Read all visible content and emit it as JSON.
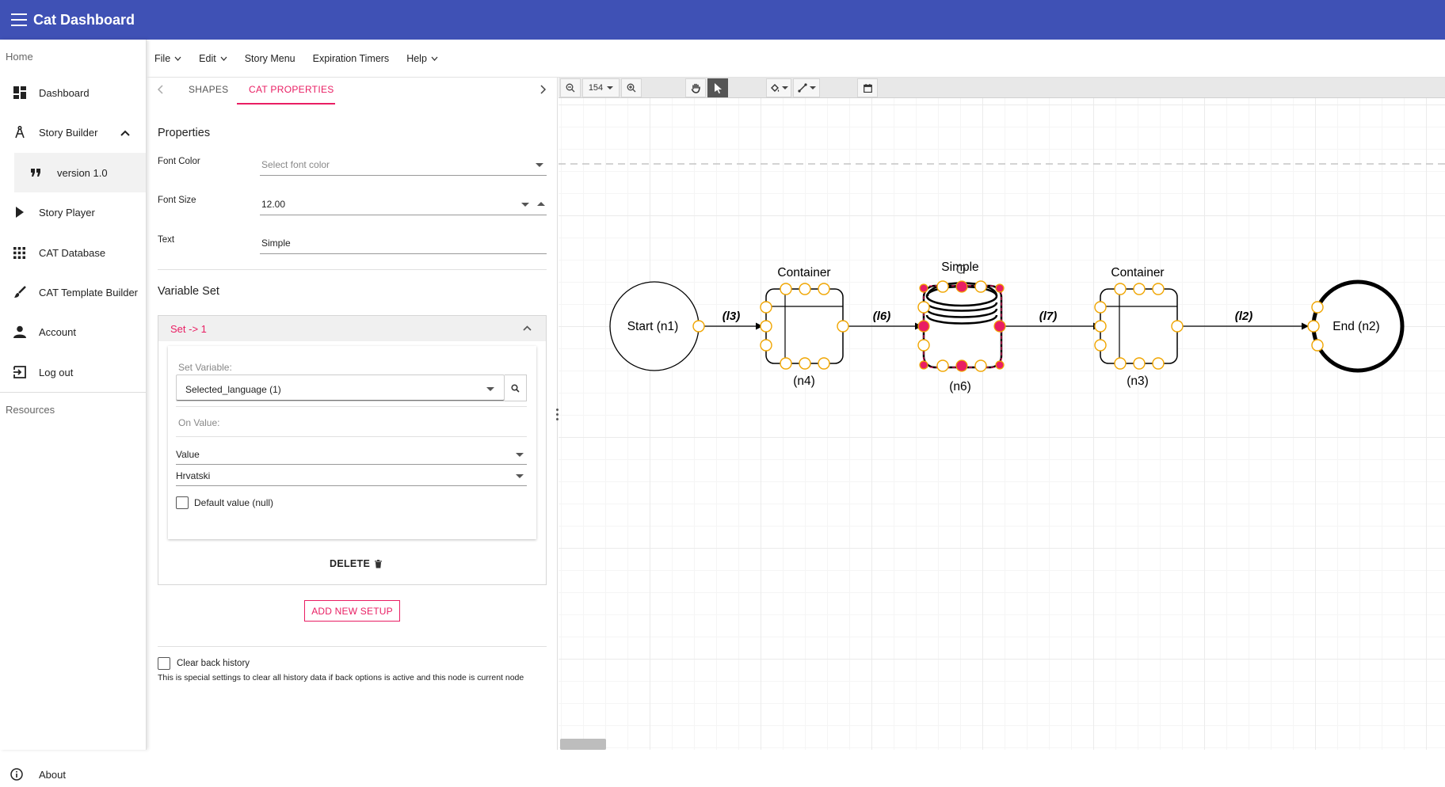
{
  "app": {
    "title": "Cat Dashboard",
    "accent": "#3f51b5",
    "highlight": "#e91e63"
  },
  "sidebar": {
    "home_label": "Home",
    "items": [
      {
        "label": "Dashboard",
        "icon": "dashboard-icon"
      },
      {
        "label": "Story Builder",
        "icon": "compass-icon",
        "expanded": true
      },
      {
        "label": "version 1.0",
        "icon": "quote-icon",
        "sub": true
      },
      {
        "label": "Story Player",
        "icon": "play-icon"
      },
      {
        "label": "CAT Database",
        "icon": "apps-grid-icon"
      },
      {
        "label": "CAT Template Builder",
        "icon": "brush-icon"
      },
      {
        "label": "Account",
        "icon": "person-icon"
      },
      {
        "label": "Log out",
        "icon": "logout-icon"
      }
    ],
    "resources_label": "Resources",
    "about_label": "About"
  },
  "menubar": {
    "items": [
      {
        "label": "File",
        "dropdown": true
      },
      {
        "label": "Edit",
        "dropdown": true
      },
      {
        "label": "Story Menu",
        "dropdown": false
      },
      {
        "label": "Expiration Timers",
        "dropdown": false
      },
      {
        "label": "Help",
        "dropdown": true
      }
    ]
  },
  "panel": {
    "tabs": [
      {
        "label": "SHAPES",
        "active": false
      },
      {
        "label": "CAT PROPERTIES",
        "active": true
      }
    ],
    "properties_title": "Properties",
    "font_color": {
      "label": "Font Color",
      "placeholder": "Select font color",
      "value": ""
    },
    "font_size": {
      "label": "Font Size",
      "value": "12.00"
    },
    "text": {
      "label": "Text",
      "value": "Simple"
    },
    "variable_set_title": "Variable Set",
    "set": {
      "header": "Set -> 1",
      "set_variable_label": "Set Variable:",
      "set_variable_value": "Selected_language (1)",
      "on_value_label": "On Value:",
      "value_select": "Value",
      "language_select": "Hrvatski",
      "default_label": "Default value (null)",
      "default_checked": false
    },
    "delete_label": "DELETE",
    "add_setup_label": "ADD NEW SETUP",
    "clear_history_label": "Clear back history",
    "clear_history_checked": false,
    "clear_history_hint": "This is special settings to clear all history data if back options is active and this node is current node"
  },
  "canvas": {
    "zoom": "154",
    "nodes": [
      {
        "id": "n1",
        "label": "Start (n1)",
        "type": "start"
      },
      {
        "id": "n4",
        "title": "Container",
        "label": "(n4)",
        "type": "container"
      },
      {
        "id": "n6",
        "title": "Simple",
        "label": "(n6)",
        "type": "simple",
        "selected": true
      },
      {
        "id": "n3",
        "title": "Container",
        "label": "(n3)",
        "type": "container"
      },
      {
        "id": "n2",
        "label": "End (n2)",
        "type": "end"
      }
    ],
    "links": [
      {
        "label": "(l3)",
        "from": "n1",
        "to": "n4"
      },
      {
        "label": "(l6)",
        "from": "n4",
        "to": "n6"
      },
      {
        "label": "(l7)",
        "from": "n6",
        "to": "n3"
      },
      {
        "label": "(l2)",
        "from": "n3",
        "to": "n2"
      }
    ]
  }
}
